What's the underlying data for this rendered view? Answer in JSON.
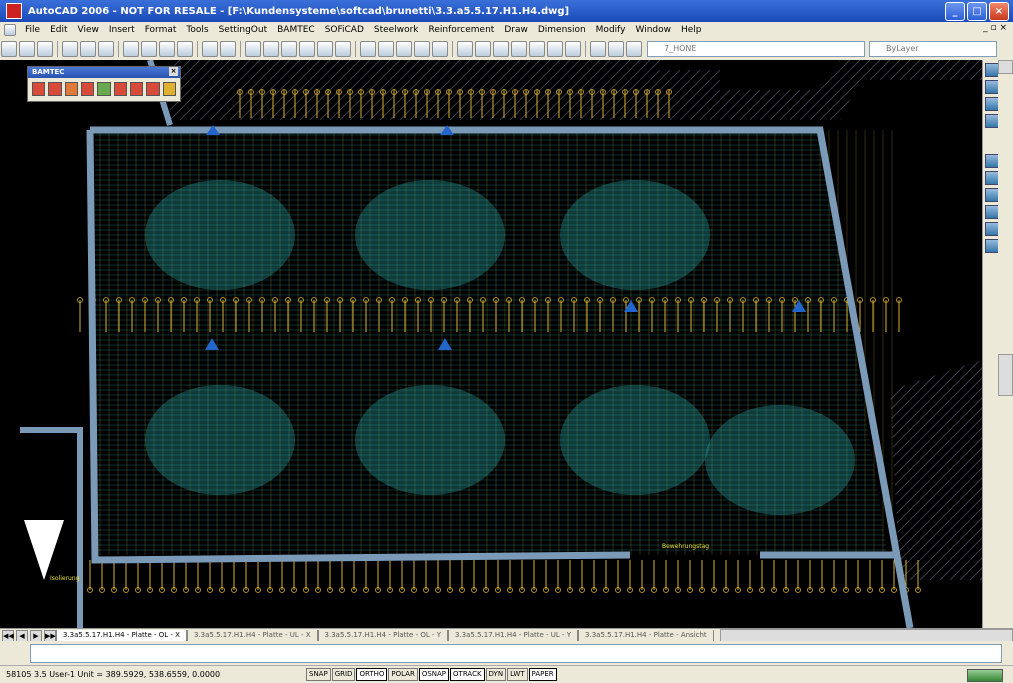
{
  "window": {
    "title": "AutoCAD 2006 - NOT FOR RESALE - [F:\\Kundensysteme\\softcad\\brunetti\\3.3.a5.5.17.H1.H4.dwg]",
    "controls": {
      "minimize": "_",
      "restore": "□",
      "close": "×"
    }
  },
  "menu": {
    "items": [
      "File",
      "Edit",
      "View",
      "Insert",
      "Format",
      "Tools",
      "SettingOut",
      "BAMTEC",
      "SOFiCAD",
      "Steelwork",
      "Reinforcement",
      "Draw",
      "Dimension",
      "Modify",
      "Window",
      "Help"
    ],
    "doc_controls": "_ ▫ ×"
  },
  "toolbar": {
    "layer_field": "7_HONE",
    "color_field": "ByLayer"
  },
  "floating_toolbar": {
    "title": "BAMTEC",
    "close": "×",
    "icon_colors": [
      "#d84a3a",
      "#d84a3a",
      "#e07a3a",
      "#d84a3a",
      "#6aa84f",
      "#d84a3a",
      "#d84a3a",
      "#d84a3a",
      "#e0b030"
    ]
  },
  "drawing": {
    "annotations": [
      "Bewehrungstag",
      "Isolierung"
    ],
    "colors": {
      "background": "#000000",
      "rebar": "#d8b030",
      "mesh": "#2aa8a8",
      "wall": "#7a9ab8",
      "marker": "#2266cc"
    }
  },
  "tabs": {
    "nav": [
      "◀◀",
      "◀",
      "▶",
      "▶▶"
    ],
    "items": [
      "3.3a5.5.17.H1.H4 - Platte - OL - X",
      "3.3a5.5.17.H1.H4 - Platte - UL - X",
      "3.3a5.5.17.H1.H4 - Platte - OL - Y",
      "3.3a5.5.17.H1.H4 - Platte - UL - Y",
      "3.3a5.5.17.H1.H4 - Platte - Ansicht"
    ]
  },
  "status": {
    "coords": "58105  3.5  User-1 Unit = 389.5929, 538.6559, 0.0000",
    "buttons": [
      {
        "label": "SNAP",
        "on": false
      },
      {
        "label": "GRID",
        "on": false
      },
      {
        "label": "ORTHO",
        "on": true
      },
      {
        "label": "POLAR",
        "on": false
      },
      {
        "label": "OSNAP",
        "on": true
      },
      {
        "label": "OTRACK",
        "on": true
      },
      {
        "label": "DYN",
        "on": false
      },
      {
        "label": "LWT",
        "on": false
      },
      {
        "label": "PAPER",
        "on": true
      }
    ]
  }
}
